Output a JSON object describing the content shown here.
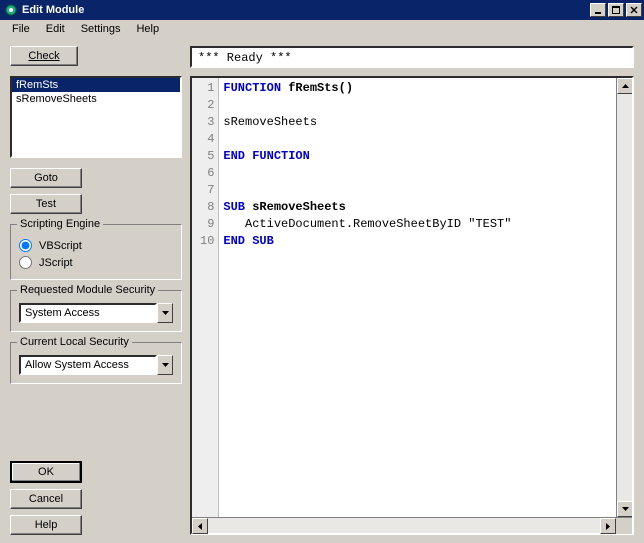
{
  "window": {
    "title": "Edit Module"
  },
  "menu": {
    "file": "File",
    "edit": "Edit",
    "settings": "Settings",
    "help": "Help"
  },
  "buttons": {
    "check": "Check",
    "goto": "Goto",
    "test": "Test",
    "ok": "OK",
    "cancel": "Cancel",
    "help": "Help"
  },
  "functionList": {
    "items": [
      "fRemSts",
      "sRemoveSheets"
    ],
    "selected": 0
  },
  "scriptingEngine": {
    "legend": "Scripting Engine",
    "options": {
      "vbscript": "VBScript",
      "jscript": "JScript"
    },
    "selected": "vbscript"
  },
  "requestedSecurity": {
    "legend": "Requested Module Security",
    "value": "System Access"
  },
  "localSecurity": {
    "legend": "Current Local Security",
    "value": "Allow System Access"
  },
  "status": "*** Ready ***",
  "code": {
    "lines": [
      {
        "n": 1,
        "segments": [
          [
            "kw",
            "FUNCTION "
          ],
          [
            "nm",
            "fRemSts()"
          ]
        ]
      },
      {
        "n": 2,
        "segments": []
      },
      {
        "n": 3,
        "segments": [
          [
            "tx",
            "sRemoveSheets"
          ]
        ]
      },
      {
        "n": 4,
        "segments": []
      },
      {
        "n": 5,
        "segments": [
          [
            "kw",
            "END FUNCTION"
          ]
        ]
      },
      {
        "n": 6,
        "segments": []
      },
      {
        "n": 7,
        "segments": []
      },
      {
        "n": 8,
        "segments": [
          [
            "kw",
            "SUB "
          ],
          [
            "nm",
            "sRemoveSheets"
          ]
        ]
      },
      {
        "n": 9,
        "segments": [
          [
            "tx",
            "   ActiveDocument.RemoveSheetByID \"TEST\""
          ]
        ]
      },
      {
        "n": 10,
        "segments": [
          [
            "kw",
            "END SUB"
          ]
        ]
      }
    ]
  }
}
